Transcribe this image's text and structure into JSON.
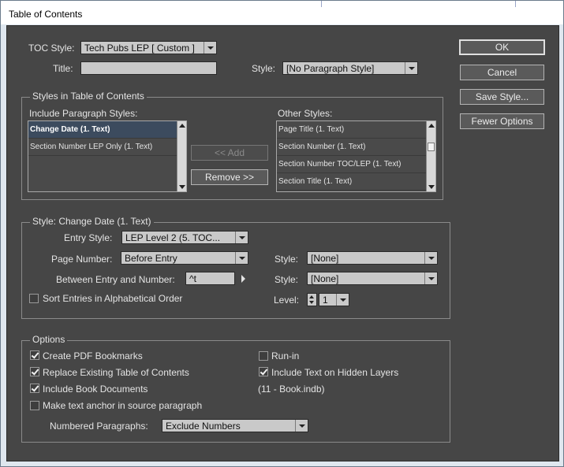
{
  "window": {
    "title": "Table of Contents"
  },
  "toc": {
    "style_label": "TOC Style:",
    "style_value": "Tech Pubs LEP [ Custom ]",
    "title_label": "Title:",
    "title_value": "",
    "title_style_label": "Style:",
    "title_style_value": "[No Paragraph Style]"
  },
  "styles_group": {
    "title": "Styles in Table of Contents",
    "include_label": "Include Paragraph Styles:",
    "include_items": [
      "Change Date (1. Text)",
      "Section Number LEP Only (1. Text)"
    ],
    "add_label": "<< Add",
    "remove_label": "Remove >>",
    "other_label": "Other Styles:",
    "other_items": [
      "Page Title (1. Text)",
      "Section Number (1. Text)",
      "Section Number TOC/LEP (1. Text)",
      "Section Title (1. Text)"
    ]
  },
  "style_group": {
    "title": "Style: Change Date (1. Text)",
    "entry_style_label": "Entry Style:",
    "entry_style_value": "LEP  Level 2 (5. TOC...",
    "page_number_label": "Page Number:",
    "page_number_value": "Before Entry",
    "page_number_style_label": "Style:",
    "page_number_style_value": "[None]",
    "between_label": "Between Entry and Number:",
    "between_value": "^t",
    "between_style_label": "Style:",
    "between_style_value": "[None]",
    "sort_label": "Sort Entries in Alphabetical Order",
    "sort_checked": false,
    "level_label": "Level:",
    "level_value": "1"
  },
  "options_group": {
    "title": "Options",
    "create_pdf_label": "Create PDF Bookmarks",
    "create_pdf_checked": true,
    "replace_label": "Replace Existing Table of Contents",
    "replace_checked": true,
    "include_book_label": "Include Book Documents",
    "include_book_checked": true,
    "anchor_label": "Make text anchor in source paragraph",
    "anchor_checked": false,
    "run_in_label": "Run-in",
    "run_in_checked": false,
    "hidden_layers_label": "Include Text on Hidden Layers",
    "hidden_layers_checked": true,
    "book_name": "(11 - Book.indb)",
    "numbered_label": "Numbered Paragraphs:",
    "numbered_value": "Exclude Numbers"
  },
  "buttons": {
    "ok": "OK",
    "cancel": "Cancel",
    "save_style": "Save Style...",
    "fewer_options": "Fewer Options"
  },
  "colors": {
    "dialog_bg": "#464646",
    "selection": "#3c4b5e",
    "field_bg": "#c9c9c9"
  }
}
